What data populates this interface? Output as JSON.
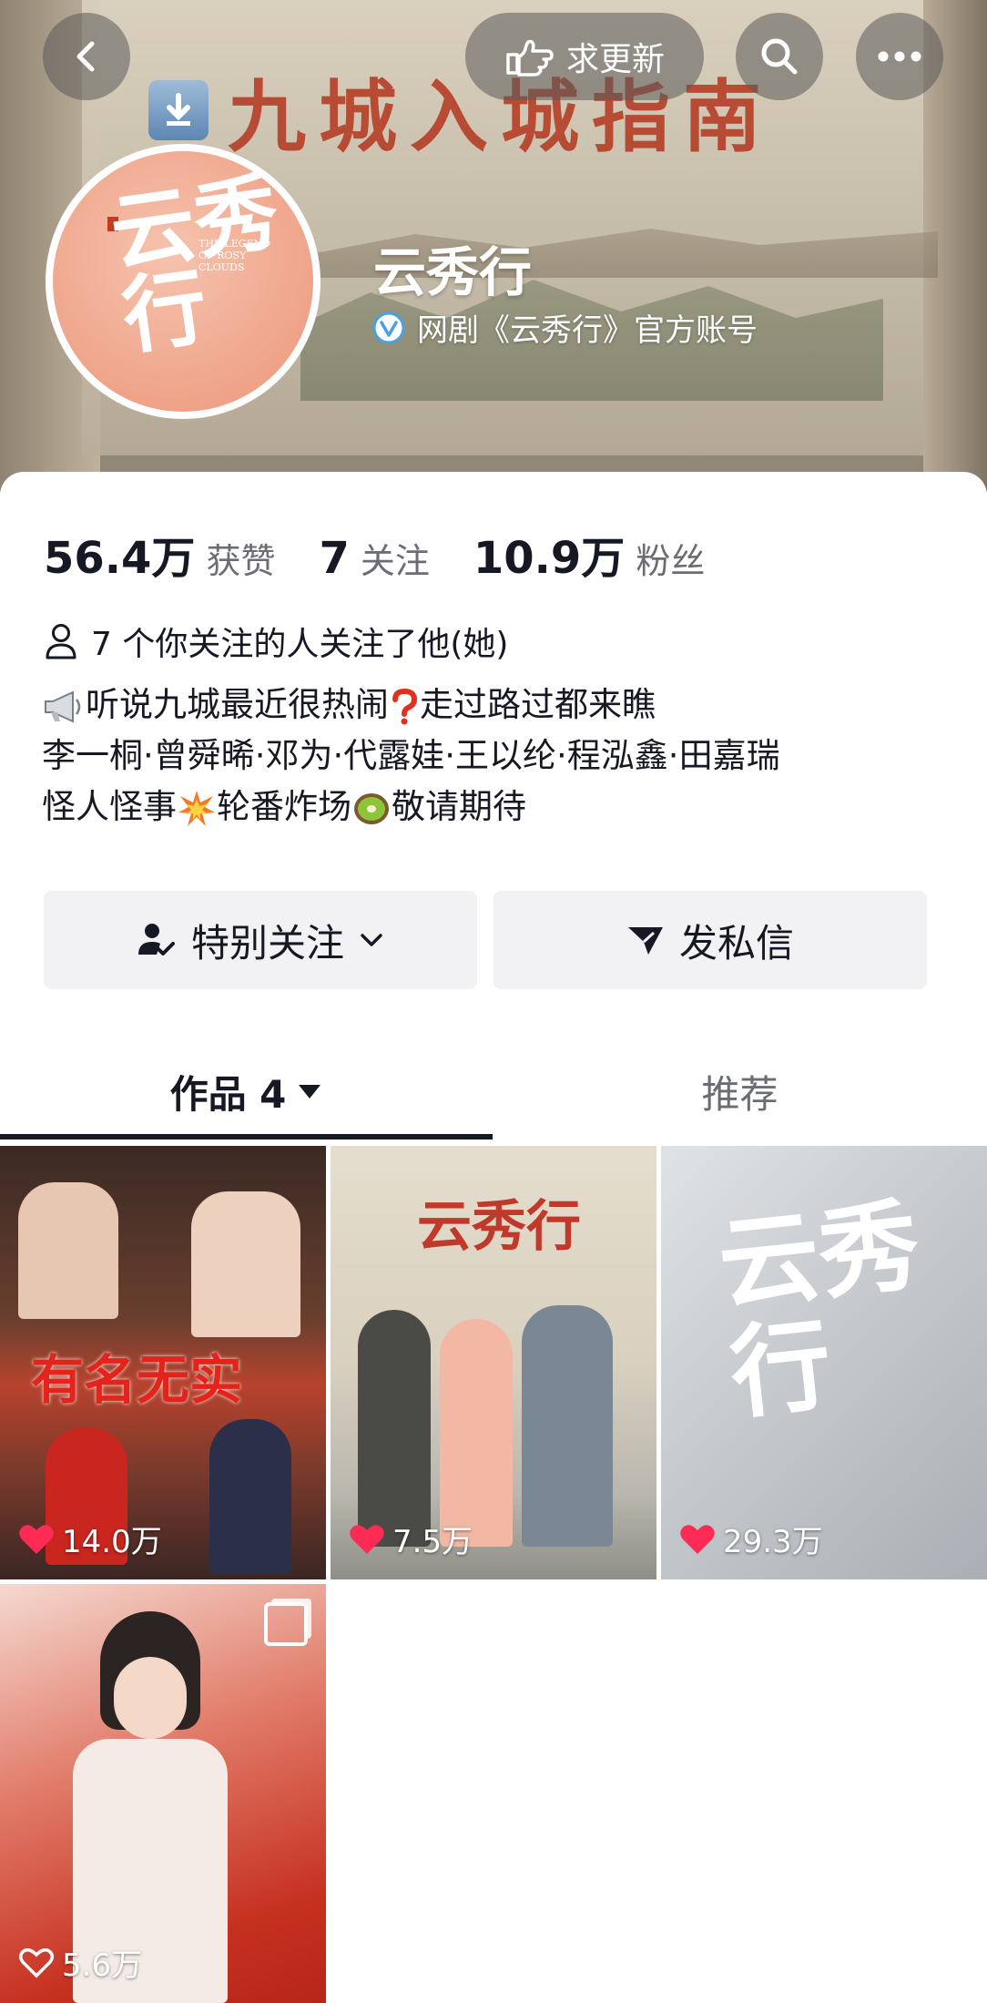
{
  "header": {
    "back_icon": "chevron-left-icon",
    "request_update_label": "求更新",
    "search_icon": "search-icon",
    "more_icon": "more-dots-icon",
    "banner_title": "九城入城指南"
  },
  "profile": {
    "avatar_title": "云秀行",
    "avatar_subtitle": "THE LEGEND OF ROSY CLOUDS",
    "name": "云秀行",
    "verified_text": "网剧《云秀行》官方账号",
    "verified_color": "#4aa0e6"
  },
  "stats": [
    {
      "value": "56.4万",
      "label": "获赞"
    },
    {
      "value": "7",
      "label": "关注"
    },
    {
      "value": "10.9万",
      "label": "粉丝"
    }
  ],
  "mutual_text": "7 个你关注的人关注了他(她)",
  "bio": {
    "line1": "听说九城最近很热闹",
    "line1b": "走过路过都来瞧",
    "line2": "李一桐·曾舜晞·邓为·代露娃·王以纶·程泓鑫·田嘉瑞",
    "line3a": "怪人怪事",
    "line3b": "轮番炸场",
    "line3c": "敬请期待"
  },
  "actions": {
    "follow_label": "特别关注",
    "message_label": "发私信"
  },
  "tabs": {
    "works_label": "作品 4",
    "recommend_label": "推荐"
  },
  "videos": [
    {
      "likes": "14.0万",
      "caption": "有名无实"
    },
    {
      "likes": "7.5万",
      "caption": "云秀行"
    },
    {
      "likes": "29.3万",
      "caption": "云秀行"
    },
    {
      "likes": "5.6万",
      "caption": ""
    }
  ],
  "colors": {
    "like_heart": "#fe2c55",
    "text_primary": "#161823",
    "text_secondary": "#6b6d76",
    "button_bg": "#f2f2f4"
  }
}
